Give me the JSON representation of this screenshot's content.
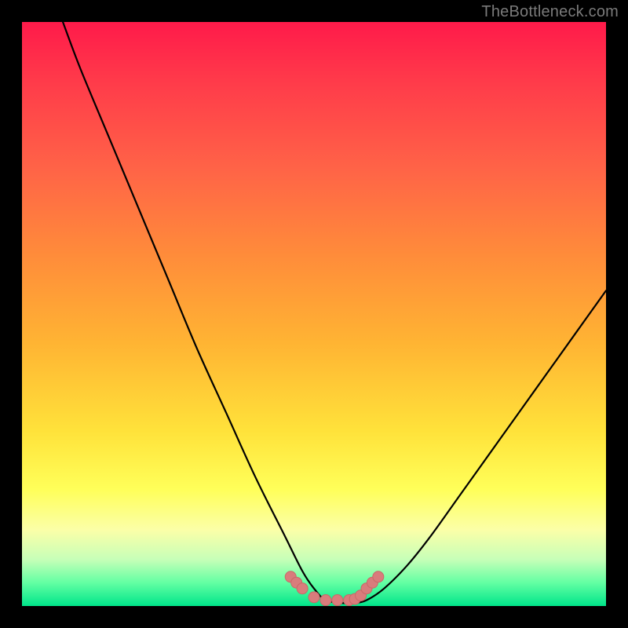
{
  "watermark": "TheBottleneck.com",
  "colors": {
    "background": "#000000",
    "curve": "#000000",
    "marker_fill": "#d97c7c",
    "marker_stroke": "#c96868",
    "gradient_top": "#ff1a4a",
    "gradient_bottom": "#00e58a"
  },
  "chart_data": {
    "type": "line",
    "title": "",
    "xlabel": "",
    "ylabel": "",
    "xlim": [
      0,
      100
    ],
    "ylim": [
      0,
      100
    ],
    "series": [
      {
        "name": "bottleneck-curve",
        "x": [
          7,
          10,
          15,
          20,
          25,
          30,
          35,
          40,
          45,
          48,
          50,
          52,
          55,
          57,
          59,
          62,
          66,
          70,
          75,
          80,
          85,
          90,
          95,
          100
        ],
        "y": [
          100,
          92,
          80,
          68,
          56,
          44,
          33,
          22,
          12,
          6,
          3,
          1,
          0.5,
          0.5,
          1,
          3,
          7,
          12,
          19,
          26,
          33,
          40,
          47,
          54
        ]
      }
    ],
    "markers": {
      "name": "highlight-points",
      "x": [
        46,
        47,
        48,
        50,
        52,
        54,
        56,
        57,
        58,
        59,
        60,
        61
      ],
      "y": [
        5,
        4,
        3,
        1.5,
        1,
        1,
        1,
        1.2,
        1.8,
        3,
        4,
        5
      ]
    }
  }
}
